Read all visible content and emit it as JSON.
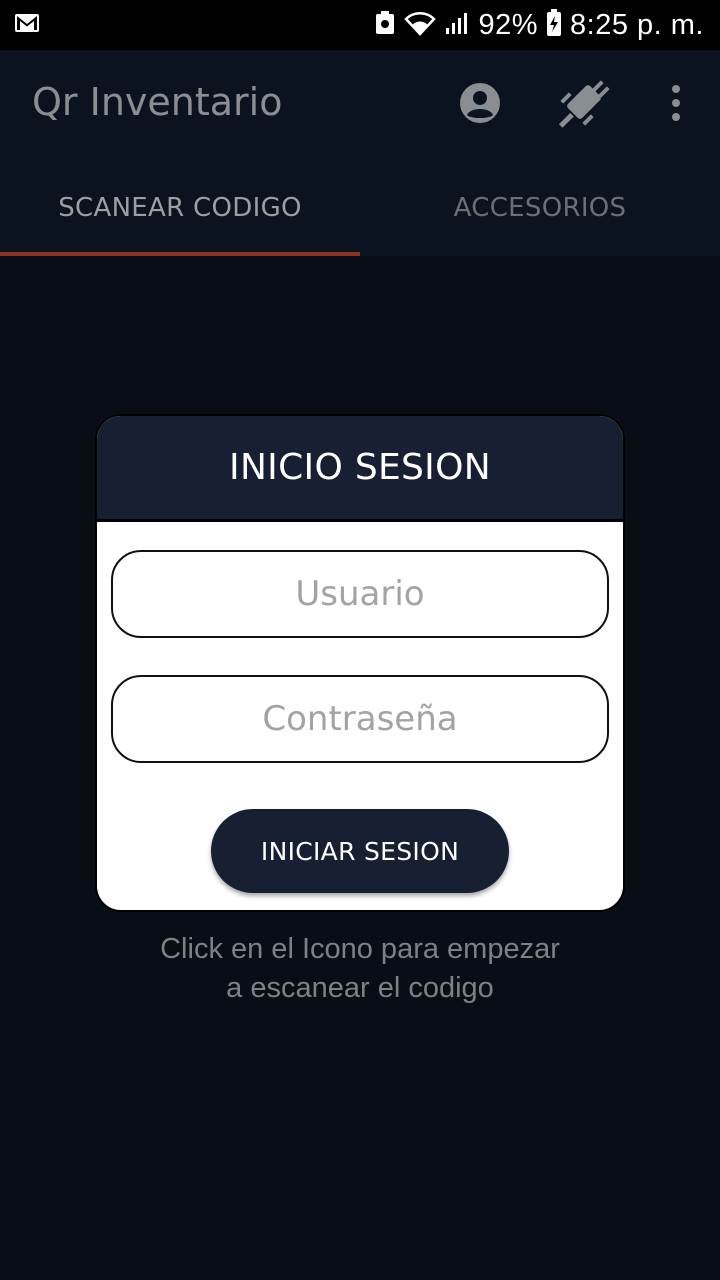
{
  "status_bar": {
    "battery_percent": "92%",
    "time": "8:25 p. m.",
    "icons": [
      "gmail-icon",
      "notification-icon",
      "wifi-icon",
      "signal-icon",
      "battery-charging-icon"
    ]
  },
  "app_bar": {
    "title": "Qr Inventario",
    "actions": [
      "account-circle-icon",
      "plug-disconnected-icon",
      "more-vert-icon"
    ]
  },
  "tabs": [
    {
      "label": "SCANEAR CODIGO",
      "active": true
    },
    {
      "label": "ACCESORIOS",
      "active": false
    }
  ],
  "login_dialog": {
    "title": "INICIO SESION",
    "username_placeholder": "Usuario",
    "username_value": "",
    "password_placeholder": "Contraseña",
    "password_value": "",
    "submit_label": "INICIAR SESION"
  },
  "hint": {
    "line1": "Click en el Icono para empezar",
    "line2": "a escanear el codigo"
  },
  "colors": {
    "background": "#090e16",
    "app_bar": "#0b1320",
    "dialog_header": "#172032",
    "tab_indicator": "#8c3323"
  }
}
